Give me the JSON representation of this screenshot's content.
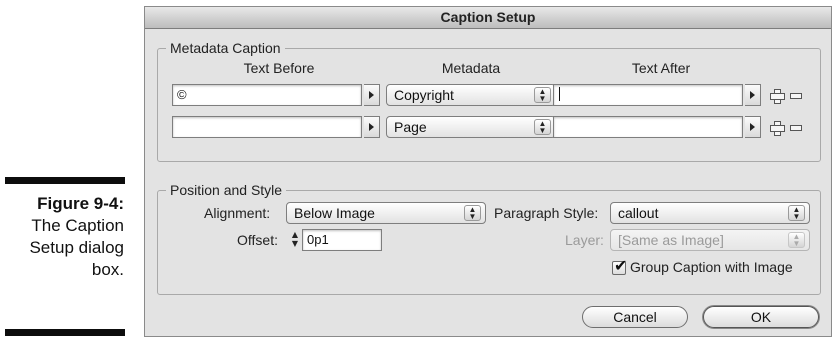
{
  "figure": {
    "number": "Figure 9-4:",
    "description": "The Caption Setup dialog box."
  },
  "dialog": {
    "title": "Caption Setup",
    "metadata_caption": {
      "group_title": "Metadata Caption",
      "headers": {
        "text_before": "Text Before",
        "metadata": "Metadata",
        "text_after": "Text After"
      },
      "rows": [
        {
          "text_before": "©",
          "metadata": "Copyright",
          "text_after": ""
        },
        {
          "text_before": "",
          "metadata": "Page",
          "text_after": ""
        }
      ]
    },
    "position_style": {
      "group_title": "Position and Style",
      "alignment_label": "Alignment:",
      "alignment_value": "Below Image",
      "offset_label": "Offset:",
      "offset_value": "0p1",
      "paragraph_style_label": "Paragraph Style:",
      "paragraph_style_value": "callout",
      "layer_label": "Layer:",
      "layer_value": "[Same as Image]",
      "group_caption_label": "Group Caption with Image",
      "group_caption_checked": true
    },
    "buttons": {
      "cancel": "Cancel",
      "ok": "OK"
    }
  },
  "icons": {
    "row_arrow": "play-triangle-icon",
    "add_row": "plus-icon",
    "remove_row": "minus-icon",
    "popup_stepper": "up-down-chevron-icon",
    "offset_stepper": "spin-arrows-icon",
    "checkmark": "checkmark-icon"
  }
}
